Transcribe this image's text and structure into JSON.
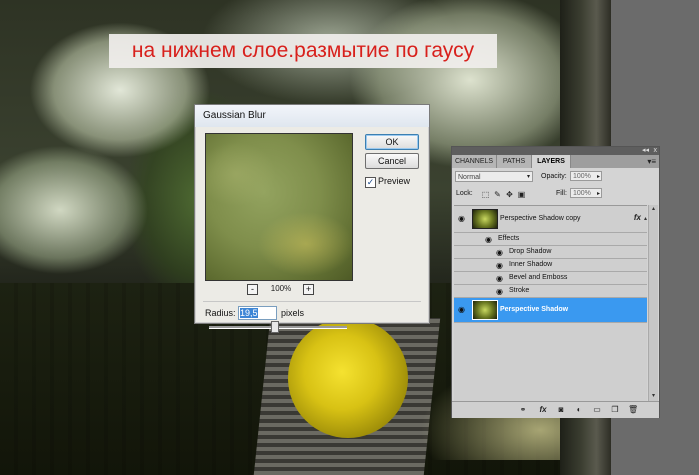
{
  "caption": "на нижнем слое.размытие по гаусу",
  "dialog": {
    "title": "Gaussian Blur",
    "ok_label": "OK",
    "cancel_label": "Cancel",
    "preview_label": "Preview",
    "preview_checked": "✓",
    "zoom_out": "-",
    "zoom_in": "+",
    "zoom_level": "100%",
    "radius_label": "Radius:",
    "radius_value": "19,5",
    "radius_unit": "pixels",
    "slider_level": 0.47
  },
  "layers_panel": {
    "header_collapse": "◂◂",
    "header_close": "x",
    "tabs": [
      "CHANNELS",
      "PATHS",
      "LAYERS"
    ],
    "active_tab": "LAYERS",
    "menu_icon": "▾≡",
    "blend_mode": "Normal",
    "opacity_label": "Opacity:",
    "opacity_value": "100%",
    "lock_label": "Lock:",
    "fill_label": "Fill:",
    "fill_value": "100%",
    "layers": [
      {
        "name": "Perspective Shadow copy",
        "fx": "fx",
        "selected": false
      },
      {
        "name": "Perspective Shadow",
        "fx": "",
        "selected": true
      }
    ],
    "effects_label": "Effects",
    "effects": [
      "Drop Shadow",
      "Inner Shadow",
      "Bevel and Emboss",
      "Stroke"
    ],
    "bottom_icons": [
      "link-icon",
      "fx-icon",
      "mask-icon",
      "adjustment-icon",
      "folder-icon",
      "new-layer-icon",
      "trash-icon"
    ]
  },
  "colors": {
    "caption_text": "#d8201c",
    "selected_layer": "#3a99f0",
    "ok_border": "#3c7fb1"
  }
}
